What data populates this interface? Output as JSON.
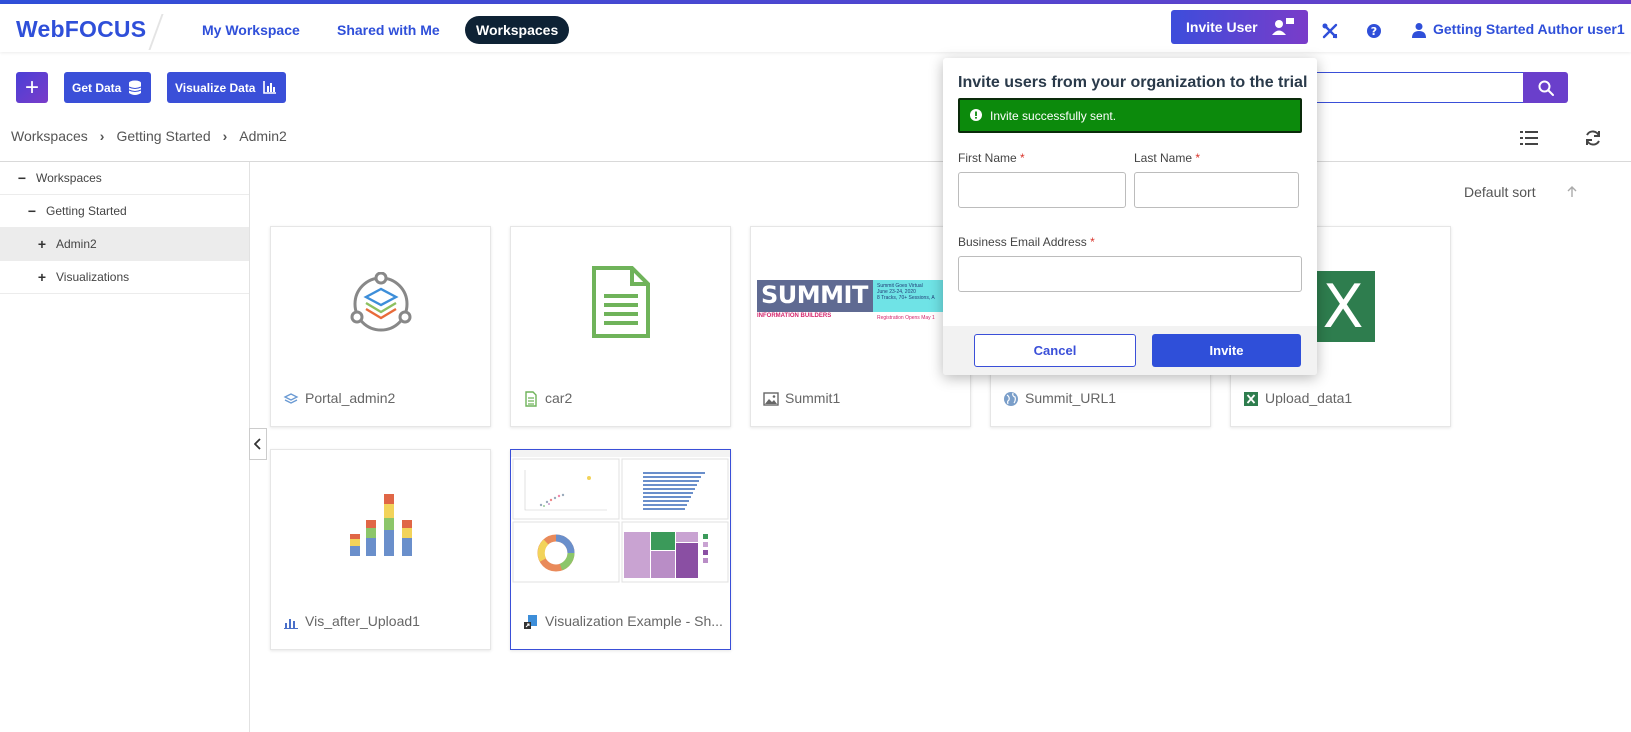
{
  "app": {
    "logo": "WebFOCUS"
  },
  "nav": {
    "tabs": [
      {
        "label": "My Workspace"
      },
      {
        "label": "Shared with Me"
      },
      {
        "label": "Workspaces"
      }
    ],
    "active_tab": "Workspaces"
  },
  "header": {
    "invite_user_label": "Invite User",
    "user_name": "Getting Started Author user1"
  },
  "toolbar": {
    "plus_label": "+",
    "get_data_label": "Get Data",
    "visualize_data_label": "Visualize Data"
  },
  "breadcrumb": {
    "items": [
      "Workspaces",
      "Getting Started",
      "Admin2"
    ]
  },
  "sidebar": {
    "items": [
      {
        "toggle": "−",
        "label": "Workspaces"
      },
      {
        "toggle": "−",
        "label": "Getting Started"
      },
      {
        "toggle": "+",
        "label": "Admin2",
        "selected": true
      },
      {
        "toggle": "+",
        "label": "Visualizations"
      }
    ]
  },
  "sort": {
    "label": "Default sort"
  },
  "cards": [
    {
      "title": "Portal_admin2",
      "icon": "portal-icon"
    },
    {
      "title": "car2",
      "icon": "document-icon"
    },
    {
      "title": "Summit1",
      "icon": "image-icon"
    },
    {
      "title": "Summit_URL1",
      "icon": "globe-icon"
    },
    {
      "title": "Upload_data1",
      "icon": "excel-icon"
    },
    {
      "title": "Vis_after_Upload1",
      "icon": "chart-icon"
    },
    {
      "title": "Visualization Example - Sh...",
      "icon": "shortcut-icon"
    }
  ],
  "summit_thumb": {
    "brand": "SUMMIT",
    "subtitle": "INFORMATION BUILDERS",
    "line1": "Summit Goes Virtual",
    "line2": "June 23-24, 2020",
    "line3": "8 Tracks, 70+ Sessions, A",
    "line4": "Registration Opens May 1"
  },
  "excel_thumb": {
    "letter": "X"
  },
  "modal": {
    "title": "Invite users from your organization to the trial",
    "alert": "Invite successfully sent.",
    "first_name_label": "First Name",
    "last_name_label": "Last Name",
    "email_label": "Business Email Address",
    "required_mark": "*",
    "cancel_label": "Cancel",
    "invite_label": "Invite",
    "first_name_value": "",
    "last_name_value": "",
    "email_value": ""
  },
  "colors": {
    "brand": "#2f4fd9",
    "accent_purple": "#6a3fcb",
    "nav_active": "#0e2235",
    "alert_green": "#0c8a0c"
  }
}
